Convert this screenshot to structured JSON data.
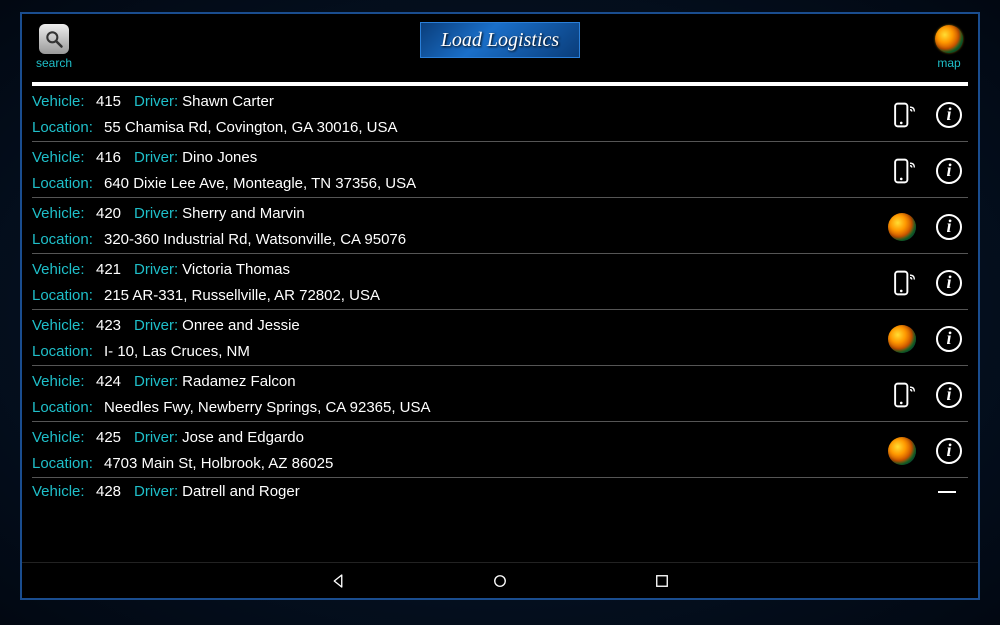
{
  "header": {
    "search_label": "search",
    "brand": "Load Logistics",
    "map_label": "map"
  },
  "labels": {
    "vehicle": "Vehicle:",
    "driver": "Driver:",
    "location": "Location:"
  },
  "rows": [
    {
      "vehicle": "415",
      "driver": "Shawn Carter",
      "location": "55 Chamisa Rd, Covington, GA 30016, USA",
      "icon": "phone"
    },
    {
      "vehicle": "416",
      "driver": "Dino Jones",
      "location": "640 Dixie Lee Ave, Monteagle, TN 37356, USA",
      "icon": "phone"
    },
    {
      "vehicle": "420",
      "driver": "Sherry  and  Marvin",
      "location": "320-360 Industrial Rd, Watsonville, CA 95076",
      "icon": "globe"
    },
    {
      "vehicle": "421",
      "driver": "Victoria Thomas",
      "location": "215 AR-331, Russellville, AR 72802, USA",
      "icon": "phone"
    },
    {
      "vehicle": "423",
      "driver": "Onree and Jessie",
      "location": "I- 10, Las Cruces, NM",
      "icon": "globe"
    },
    {
      "vehicle": "424",
      "driver": "Radamez Falcon",
      "location": "Needles Fwy, Newberry Springs, CA 92365, USA",
      "icon": "phone"
    },
    {
      "vehicle": "425",
      "driver": "Jose  and  Edgardo",
      "location": "4703 Main St, Holbrook, AZ 86025",
      "icon": "globe"
    },
    {
      "vehicle": "428",
      "driver": "Datrell and Roger",
      "location": "",
      "icon": "dash"
    }
  ]
}
